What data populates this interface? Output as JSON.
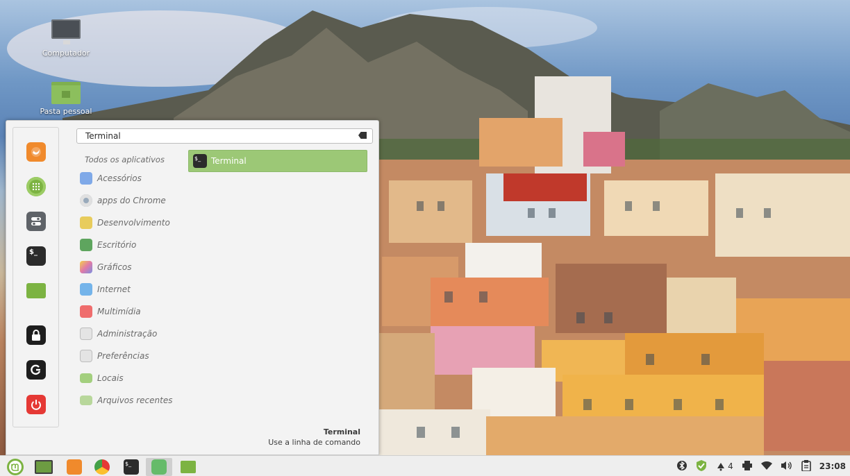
{
  "desktop": {
    "icons": [
      {
        "label": "Computador",
        "icon": "monitor-icon"
      },
      {
        "label": "Pasta pessoal",
        "icon": "home-folder-icon"
      }
    ]
  },
  "menu": {
    "favorites": [
      {
        "name": "firefox-icon"
      },
      {
        "name": "software-manager-icon"
      },
      {
        "name": "settings-icon"
      },
      {
        "name": "terminal-icon"
      },
      {
        "name": "files-icon"
      },
      {
        "name": "lock-icon"
      },
      {
        "name": "logout-icon"
      },
      {
        "name": "power-icon"
      }
    ],
    "search": {
      "value": "Terminal"
    },
    "categories": [
      {
        "label": "Todos os aplicativos"
      },
      {
        "label": "Acessórios",
        "icon": "accessories-icon",
        "color": "#7fa9e8"
      },
      {
        "label": "apps do Chrome",
        "icon": "chrome-apps-icon",
        "color": "#c7c7c7"
      },
      {
        "label": "Desenvolvimento",
        "icon": "development-icon",
        "color": "#e8cc5c"
      },
      {
        "label": "Escritório",
        "icon": "office-icon",
        "color": "#5ea55e"
      },
      {
        "label": "Gráficos",
        "icon": "graphics-icon",
        "color": "#e07aa8"
      },
      {
        "label": "Internet",
        "icon": "internet-icon",
        "color": "#74b4ea"
      },
      {
        "label": "Multimídia",
        "icon": "multimedia-icon",
        "color": "#ef6d6d"
      },
      {
        "label": "Administração",
        "icon": "administration-icon",
        "color": "#dcdcdc"
      },
      {
        "label": "Preferências",
        "icon": "preferences-icon",
        "color": "#dcdcdc"
      },
      {
        "label": "Locais",
        "icon": "places-icon",
        "color": "#a3cf7e"
      },
      {
        "label": "Arquivos recentes",
        "icon": "recent-files-icon",
        "color": "#b8d79b"
      }
    ],
    "results": [
      {
        "label": "Terminal",
        "icon": "terminal-icon"
      }
    ],
    "description": {
      "name": "Terminal",
      "text": "Use a linha de comando"
    }
  },
  "taskbar": {
    "clock": "23:08",
    "notification_count": "4",
    "accent": "#7cb342"
  }
}
